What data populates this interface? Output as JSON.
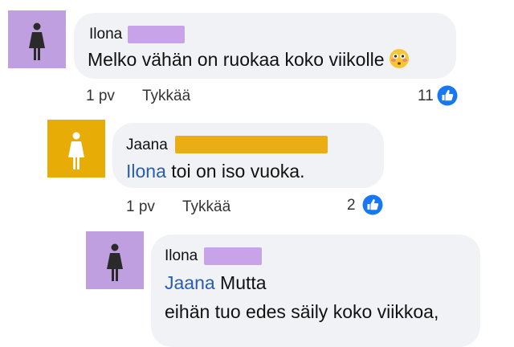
{
  "comments": [
    {
      "author": "Ilona",
      "avatar_icon": "female-figure-icon",
      "avatar_color": "#bf9fe0",
      "redaction_color": "#c9a3ea",
      "text": "Melko vähän on ruokaa koko viikolle",
      "emoji": "flushed-face-icon",
      "time": "1 pv",
      "like_label": "Tykkää",
      "like_count": "11"
    },
    {
      "author": "Jaana",
      "avatar_icon": "female-figure-icon",
      "avatar_color": "#e8ac06",
      "redaction_color": "#ebad14",
      "mention": "Ilona",
      "text": " toi on iso vuoka.",
      "time": "1 pv",
      "like_label": "Tykkää",
      "like_count": "2"
    },
    {
      "author": "Ilona",
      "avatar_icon": "female-figure-icon",
      "avatar_color": "#bf9fe0",
      "redaction_color": "#c9a3ea",
      "mention": "Jaana",
      "text": " Mutta",
      "text2": "eihän tuo edes säily koko viikkoa,"
    }
  ],
  "colors": {
    "like_blue": "#1877f2",
    "mention_blue": "#2a5db0",
    "bubble_gray": "#f0f2f5"
  }
}
